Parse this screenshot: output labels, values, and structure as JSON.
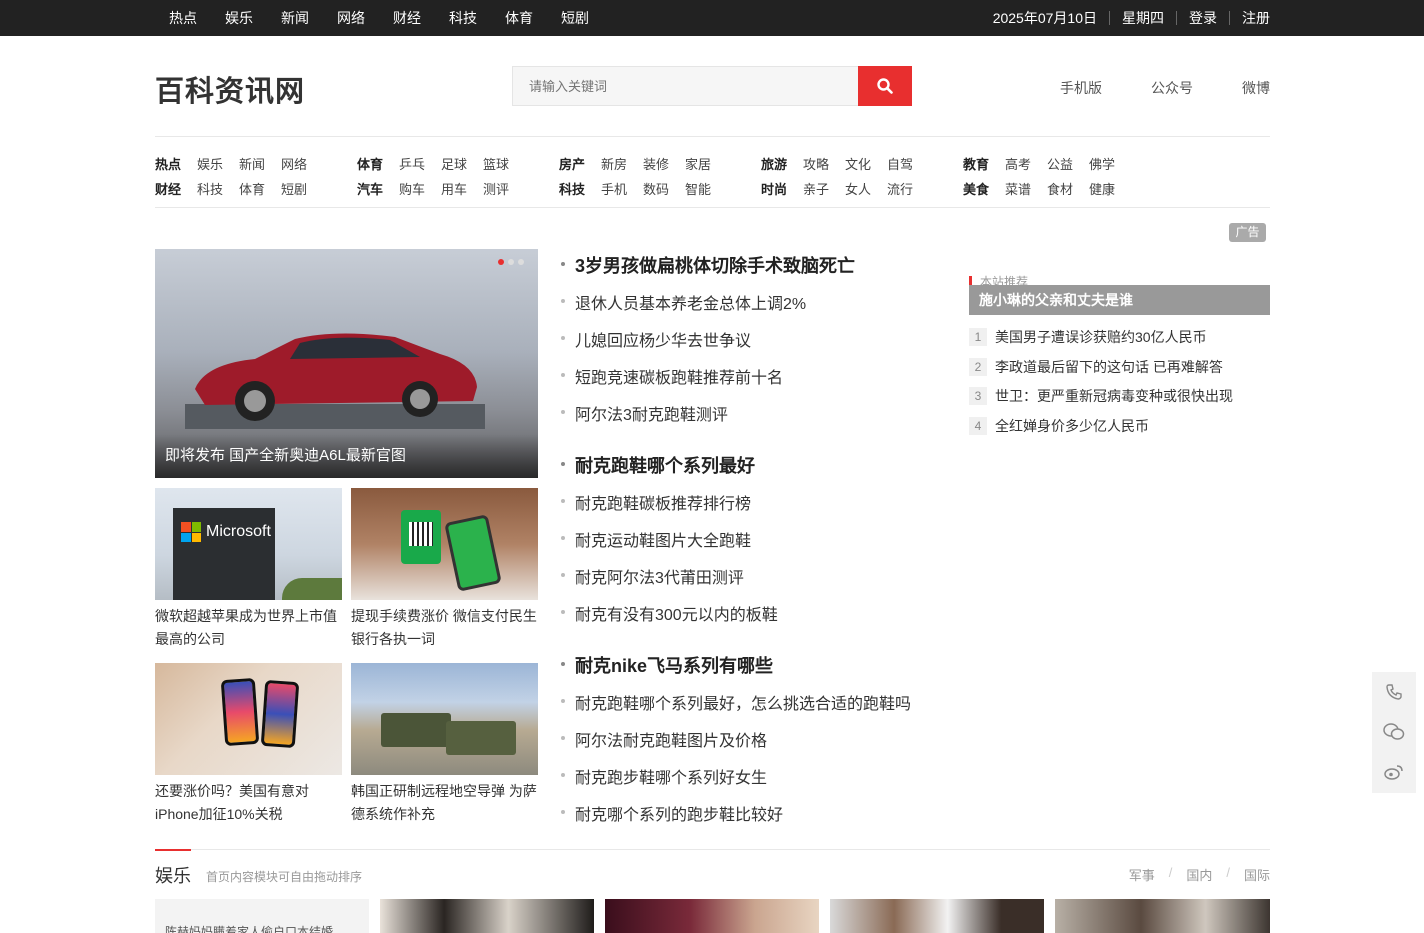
{
  "topbar": {
    "nav": [
      "热点",
      "娱乐",
      "新闻",
      "网络",
      "财经",
      "科技",
      "体育",
      "短剧"
    ],
    "date": "2025年07月10日",
    "weekday": "星期四",
    "login": "登录",
    "register": "注册"
  },
  "header": {
    "logo": "百科资讯网",
    "search_placeholder": "请输入关键词",
    "links": [
      "手机版",
      "公众号",
      "微博"
    ]
  },
  "catnav": [
    {
      "rows": [
        [
          "热点",
          "娱乐",
          "新闻",
          "网络"
        ],
        [
          "财经",
          "科技",
          "体育",
          "短剧"
        ]
      ]
    },
    {
      "rows": [
        [
          "体育",
          "乒乓",
          "足球",
          "篮球"
        ],
        [
          "汽车",
          "购车",
          "用车",
          "测评"
        ]
      ]
    },
    {
      "rows": [
        [
          "房产",
          "新房",
          "装修",
          "家居"
        ],
        [
          "科技",
          "手机",
          "数码",
          "智能"
        ]
      ]
    },
    {
      "rows": [
        [
          "旅游",
          "攻略",
          "文化",
          "自驾"
        ],
        [
          "时尚",
          "亲子",
          "女人",
          "流行"
        ]
      ]
    },
    {
      "rows": [
        [
          "教育",
          "高考",
          "公益",
          "佛学"
        ],
        [
          "美食",
          "菜谱",
          "食材",
          "健康"
        ]
      ]
    }
  ],
  "ad_tag": "广告",
  "hero": {
    "caption": "即将发布 国产全新奥迪A6L最新官图"
  },
  "thumbs": [
    {
      "title": "微软超越苹果成为世界上市值最高的公司",
      "brand": "Microsoft"
    },
    {
      "title": "提现手续费涨价 微信支付民生银行各执一词"
    },
    {
      "title": "还要涨价吗？美国有意对iPhone加征10%关税"
    },
    {
      "title": "韩国正研制远程地空导弹 为萨德系统作补充"
    }
  ],
  "news": [
    {
      "text": "3岁男孩做扁桃体切除手术致脑死亡",
      "head": true
    },
    {
      "text": "退休人员基本养老金总体上调2%"
    },
    {
      "text": "儿媳回应杨少华去世争议"
    },
    {
      "text": "短跑竞速碳板跑鞋推荐前十名"
    },
    {
      "text": "阿尔法3耐克跑鞋测评"
    },
    {
      "text": "耐克跑鞋哪个系列最好",
      "head": true
    },
    {
      "text": "耐克跑鞋碳板推荐排行榜"
    },
    {
      "text": "耐克运动鞋图片大全跑鞋"
    },
    {
      "text": "耐克阿尔法3代莆田测评"
    },
    {
      "text": "耐克有没有300元以内的板鞋"
    },
    {
      "text": "耐克nike飞马系列有哪些",
      "head": true
    },
    {
      "text": "耐克跑鞋哪个系列最好，怎么挑选合适的跑鞋吗"
    },
    {
      "text": "阿尔法耐克跑鞋图片及价格"
    },
    {
      "text": "耐克跑步鞋哪个系列好女生"
    },
    {
      "text": "耐克哪个系列的跑步鞋比较好"
    }
  ],
  "recommend": {
    "title": "本站推荐",
    "banner": "施小琳的父亲和丈夫是谁",
    "ranks": [
      {
        "num": "1",
        "text": "美国男子遭误诊获赔约30亿人民币"
      },
      {
        "num": "2",
        "text": "李政道最后留下的这句话 已再难解答"
      },
      {
        "num": "3",
        "text": "世卫：更严重新冠病毒变种或很快出现"
      },
      {
        "num": "4",
        "text": "全红婵身价多少亿人民币"
      }
    ]
  },
  "section": {
    "name": "娱乐",
    "desc": "首页内容模块可自由拖动排序",
    "tabs": [
      "军事",
      "国内",
      "国际"
    ]
  },
  "bottom_first_caption": "陈赫妈妈瞒着家人偷户口本结婚",
  "colors": {
    "accent": "#e82f2f",
    "topbar": "#222222"
  }
}
